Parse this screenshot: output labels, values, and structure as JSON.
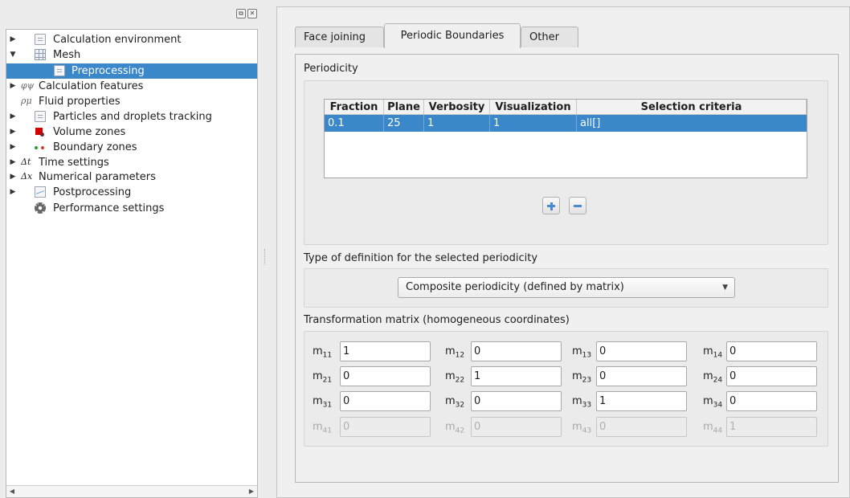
{
  "tree": {
    "items": [
      {
        "label": "Calculation environment",
        "arrow": "▶",
        "icon": "document-icon"
      },
      {
        "label": "Mesh",
        "arrow": "▼",
        "icon": "mesh-grid-icon"
      },
      {
        "label": "Preprocessing",
        "arrow": "",
        "icon": "document-icon",
        "selected": true
      },
      {
        "label": "Calculation features",
        "arrow": "▶",
        "icon_text": "φψ"
      },
      {
        "label": "Fluid properties",
        "arrow": "",
        "icon_text": "ρμ"
      },
      {
        "label": "Particles and droplets tracking",
        "arrow": "▶",
        "icon": "document-icon"
      },
      {
        "label": "Volume zones",
        "arrow": "▶",
        "icon": "volume-zones-icon"
      },
      {
        "label": "Boundary zones",
        "arrow": "▶",
        "icon": "boundary-zones-icon"
      },
      {
        "label": "Time settings",
        "arrow": "▶",
        "icon_text": "Δt"
      },
      {
        "label": "Numerical parameters",
        "arrow": "▶",
        "icon_text": "Δx"
      },
      {
        "label": "Postprocessing",
        "arrow": "▶",
        "icon": "postprocessing-icon"
      },
      {
        "label": "Performance settings",
        "arrow": "",
        "icon": "gear-icon"
      }
    ]
  },
  "tabs": [
    {
      "label": "Face joining",
      "active": false
    },
    {
      "label": "Periodic Boundaries",
      "active": true
    },
    {
      "label": "Other",
      "active": false
    }
  ],
  "periodicity": {
    "title": "Periodicity",
    "columns": [
      "Fraction",
      "Plane",
      "Verbosity",
      "Visualization",
      "Selection criteria"
    ],
    "rows": [
      [
        "0.1",
        "25",
        "1",
        "1",
        "all[]"
      ]
    ]
  },
  "definition": {
    "label": "Type of definition for the selected periodicity",
    "selected": "Composite periodicity (defined by matrix)"
  },
  "matrix": {
    "title": "Transformation matrix (homogeneous coordinates)",
    "labels": [
      [
        "11",
        "12",
        "13",
        "14"
      ],
      [
        "21",
        "22",
        "23",
        "24"
      ],
      [
        "31",
        "32",
        "33",
        "34"
      ],
      [
        "41",
        "42",
        "43",
        "44"
      ]
    ],
    "values": [
      [
        "1",
        "0",
        "0",
        "0"
      ],
      [
        "0",
        "1",
        "0",
        "0"
      ],
      [
        "0",
        "0",
        "1",
        "0"
      ],
      [
        "0",
        "0",
        "0",
        "1"
      ]
    ]
  }
}
